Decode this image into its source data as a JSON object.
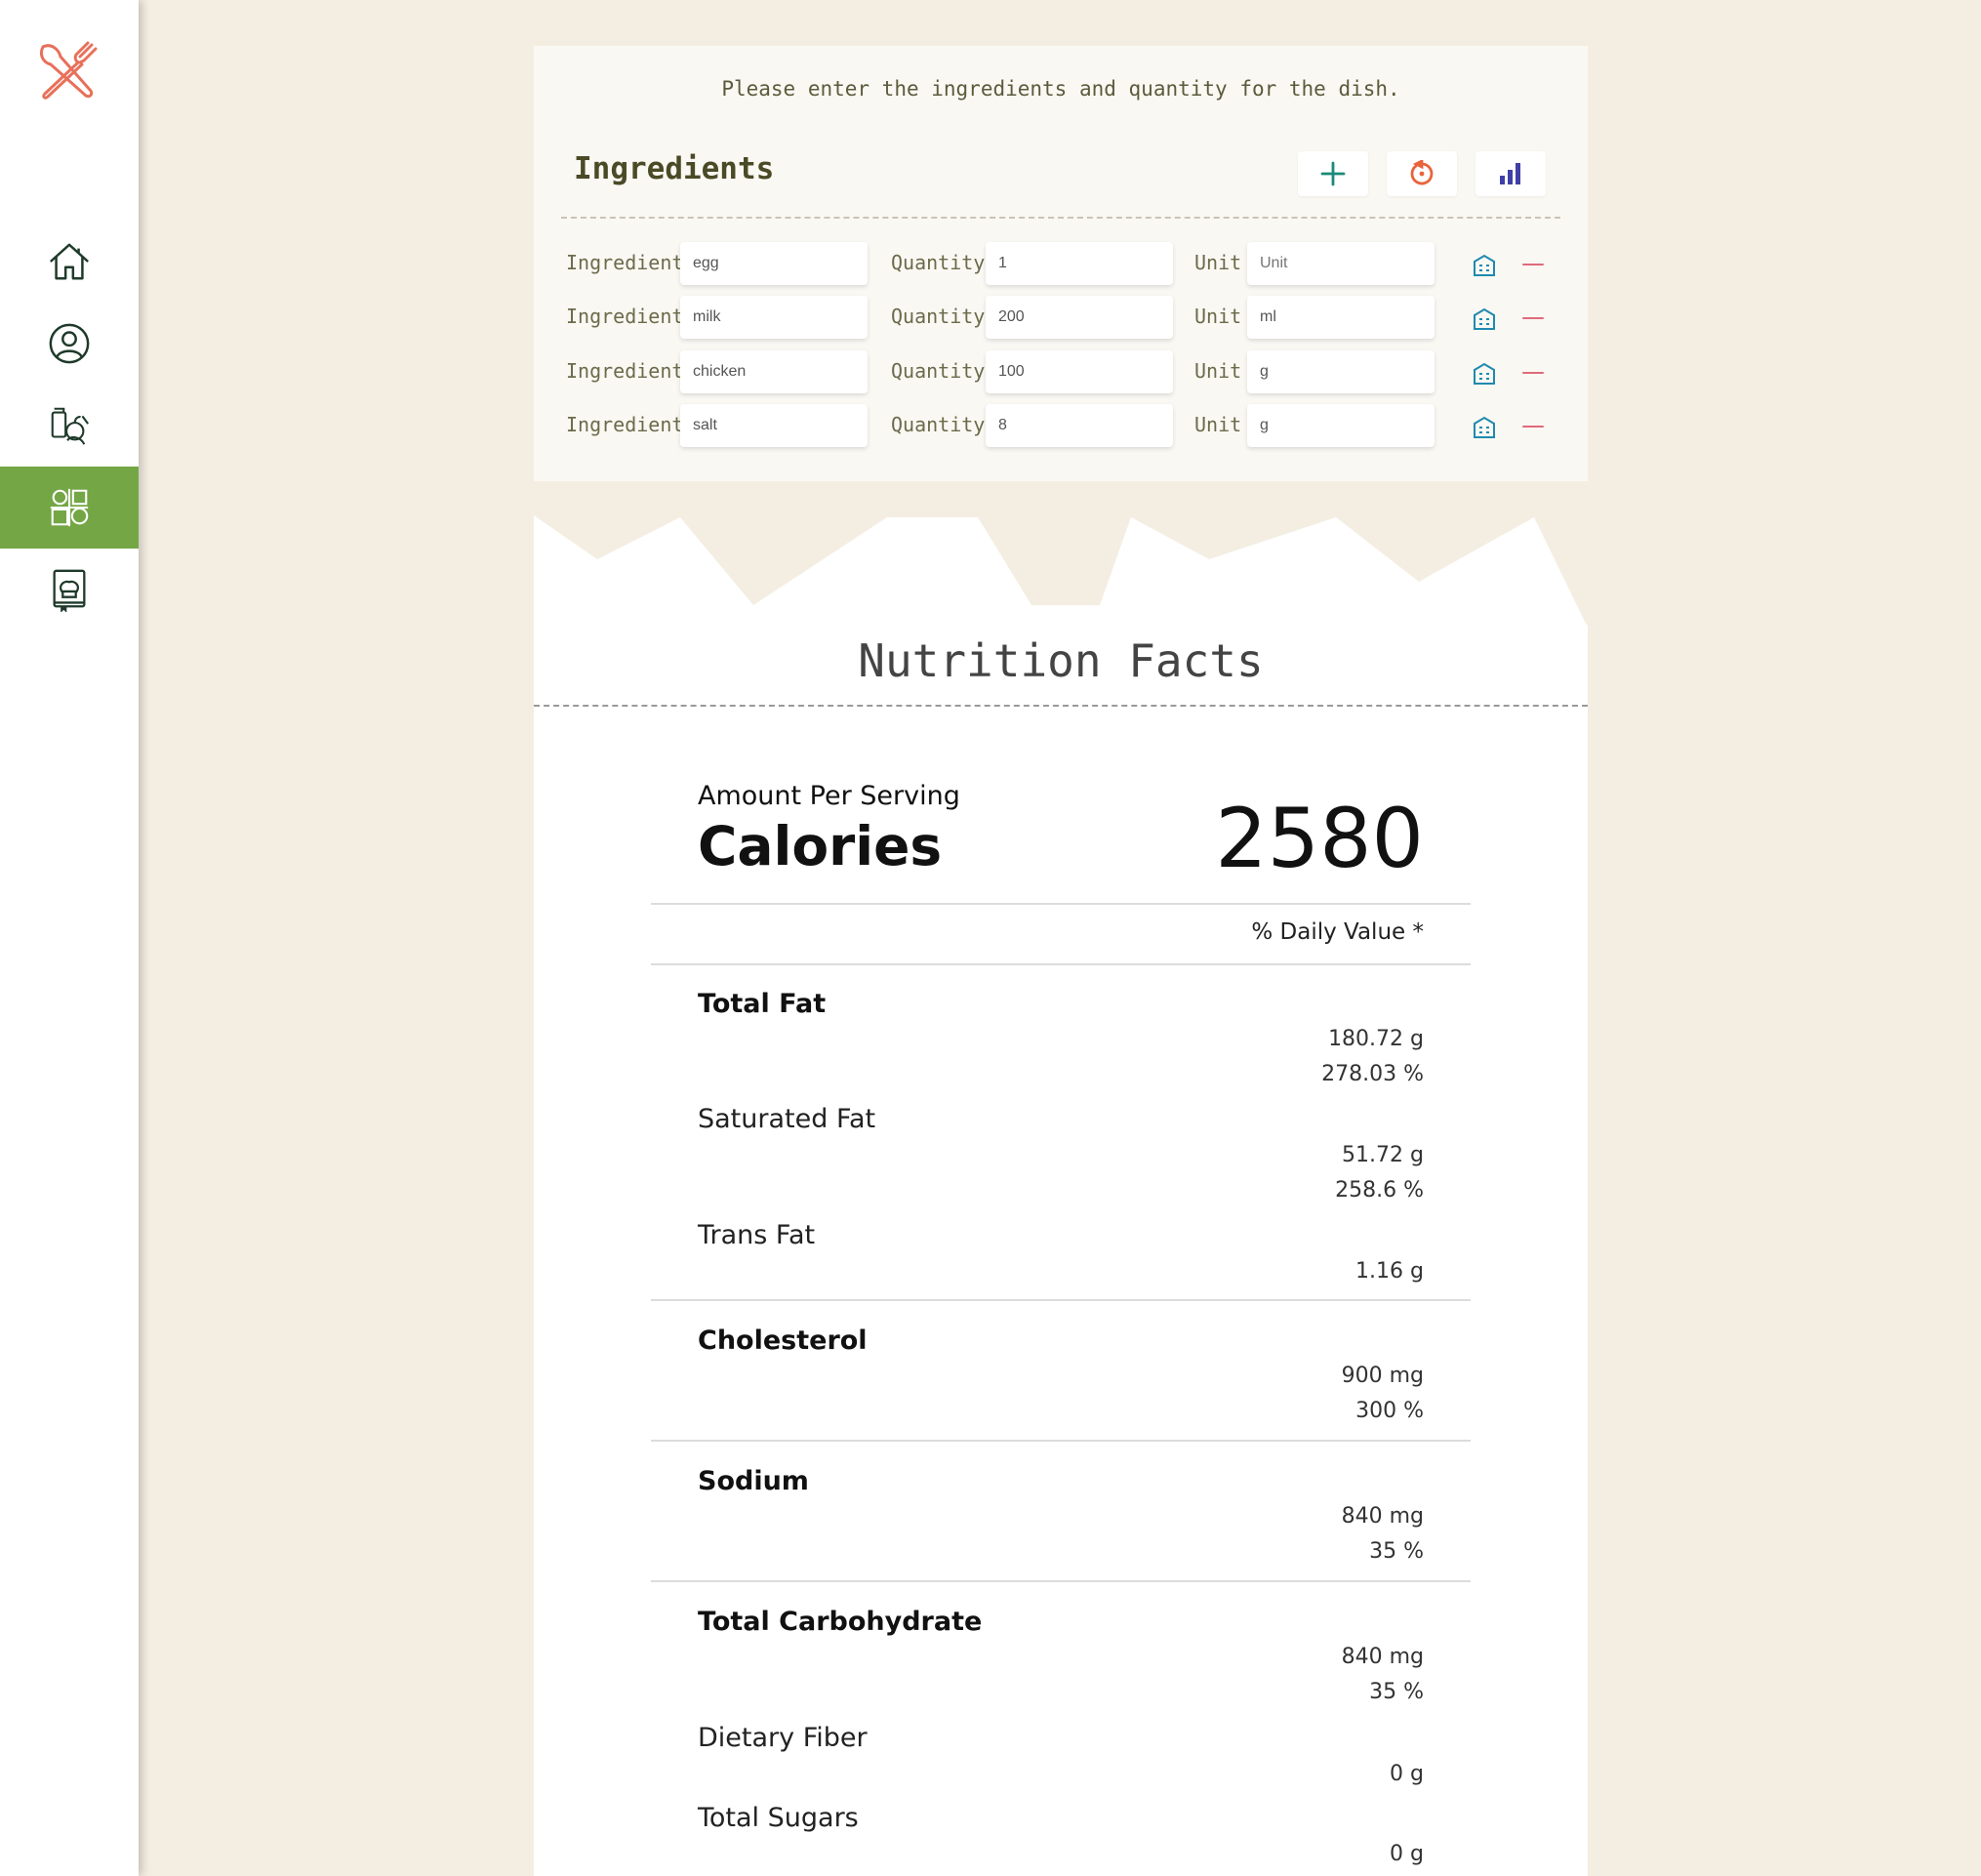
{
  "sidebar": {
    "logo_icon": "crossed-utensils-icon",
    "items": [
      {
        "icon": "home-icon"
      },
      {
        "icon": "user-icon"
      },
      {
        "icon": "groceries-icon"
      },
      {
        "icon": "ingredients-icon",
        "active": true
      },
      {
        "icon": "recipe-book-icon"
      }
    ],
    "active_color": "#74a645"
  },
  "ingredients": {
    "message": "Please enter the ingredients and quantity for the dish.",
    "title": "Ingredients",
    "toolbar": [
      {
        "icon": "add-icon",
        "color": "#1a8a7a"
      },
      {
        "icon": "reset-icon",
        "color": "#e8643c"
      },
      {
        "icon": "bar-chart-icon",
        "color": "#3f3fa8"
      }
    ],
    "labels": {
      "ingredient": "Ingredient",
      "quantity": "Quantity",
      "unit": "Unit"
    },
    "rows": [
      {
        "ingredient": "egg",
        "quantity": "1",
        "unit": "",
        "unit_placeholder": "Unit"
      },
      {
        "ingredient": "milk",
        "quantity": "200",
        "unit": "ml",
        "unit_placeholder": "Unit"
      },
      {
        "ingredient": "chicken",
        "quantity": "100",
        "unit": "g",
        "unit_placeholder": "Unit"
      },
      {
        "ingredient": "salt",
        "quantity": "8",
        "unit": "g",
        "unit_placeholder": "Unit"
      }
    ]
  },
  "nutrition": {
    "title": "Nutrition Facts",
    "amount_per_serving": "Amount Per Serving",
    "calories_label": "Calories",
    "calories_value": "2580",
    "daily_value_header": "% Daily Value *",
    "total_fat": {
      "label": "Total Fat",
      "amount": "180.72 g",
      "percent": "278.03 %"
    },
    "saturated_fat": {
      "label": "Saturated Fat",
      "amount": "51.72 g",
      "percent": "258.6 %"
    },
    "trans_fat": {
      "label": "Trans Fat",
      "amount": "1.16 g"
    },
    "cholesterol": {
      "label": "Cholesterol",
      "amount": "900 mg",
      "percent": "300 %"
    },
    "sodium": {
      "label": "Sodium",
      "amount": "840 mg",
      "percent": "35 %"
    },
    "total_carbohydrate": {
      "label": "Total Carbohydrate",
      "amount": "840 mg",
      "percent": "35 %"
    },
    "dietary_fiber": {
      "label": "Dietary Fiber",
      "amount": "0 g"
    },
    "total_sugars": {
      "label": "Total Sugars",
      "amount": "0 g"
    }
  }
}
